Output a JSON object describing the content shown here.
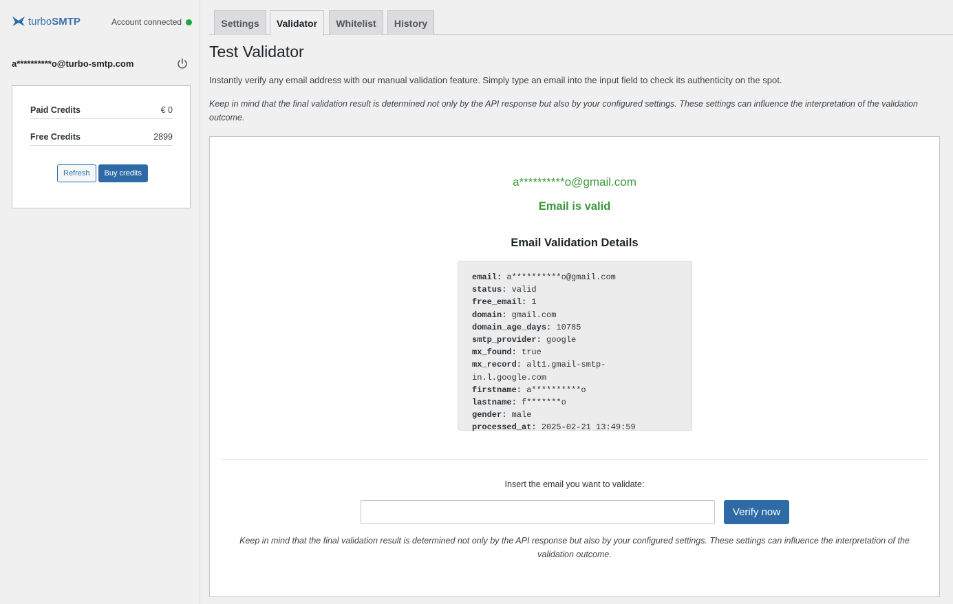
{
  "sidebar": {
    "logo_prefix": "turbo",
    "logo_suffix": "SMTP",
    "account_status": "Account connected",
    "user_email": "a**********o@turbo-smtp.com",
    "credits": [
      {
        "label": "Paid Credits",
        "value": "€ 0"
      },
      {
        "label": "Free Credits",
        "value": "2899"
      }
    ],
    "refresh_label": "Refresh",
    "buy_label": "Buy credits"
  },
  "tabs": [
    {
      "label": "Settings",
      "active": false
    },
    {
      "label": "Validator",
      "active": true
    },
    {
      "label": "Whitelist",
      "active": false
    },
    {
      "label": "History",
      "active": false
    }
  ],
  "main": {
    "title": "Test Validator",
    "intro": "Instantly verify any email address with our manual validation feature. Simply type an email into the input field to check its authenticity on the spot.",
    "note": "Keep in mind that the final validation result is determined not only by the API response but also by your configured settings. These settings can influence the interpretation of the validation outcome.",
    "result_email": "a**********o@gmail.com",
    "result_status": "Email is valid",
    "details_title": "Email Validation Details",
    "details": [
      {
        "key": "email:",
        "value": "a**********o@gmail.com"
      },
      {
        "key": "status:",
        "value": "valid"
      },
      {
        "key": "free_email:",
        "value": "1"
      },
      {
        "key": "domain:",
        "value": "gmail.com"
      },
      {
        "key": "domain_age_days:",
        "value": "10785"
      },
      {
        "key": "smtp_provider:",
        "value": "google"
      },
      {
        "key": "mx_found:",
        "value": "true"
      },
      {
        "key": "mx_record:",
        "value": "alt1.gmail-smtp-in.l.google.com"
      },
      {
        "key": "firstname:",
        "value": "a**********o"
      },
      {
        "key": "lastname:",
        "value": "f*******o"
      },
      {
        "key": "gender:",
        "value": "male"
      },
      {
        "key": "processed_at:",
        "value": "2025-02-21 13:49:59"
      }
    ],
    "insert_label": "Insert the email you want to validate:",
    "input_value": "",
    "verify_label": "Verify now",
    "bottom_note": "Keep in mind that the final validation result is determined not only by the API response but also by your configured settings. These settings can influence the interpretation of the validation outcome."
  },
  "colors": {
    "accent": "#2e6aa6",
    "success": "#3a9a3a",
    "status_dot": "#1ea640"
  }
}
